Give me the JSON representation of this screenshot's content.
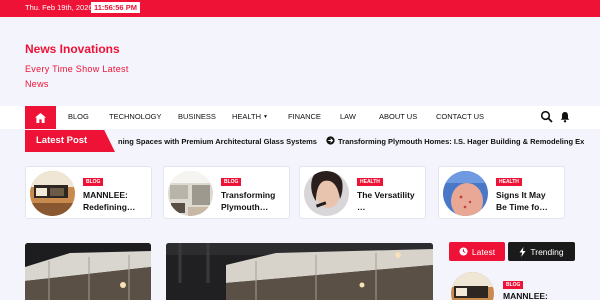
{
  "topbar": {
    "date": "Thu. Feb 19th, 2026",
    "time": "11:56:56 PM"
  },
  "site": {
    "title": "News Inovations",
    "tagline": "Every Time Show Latest News"
  },
  "nav": {
    "items": [
      {
        "label": "BLOG"
      },
      {
        "label": "TECHNOLOGY"
      },
      {
        "label": "BUSINESS"
      },
      {
        "label": "HEALTH"
      },
      {
        "label": "FINANCE"
      },
      {
        "label": "LAW"
      },
      {
        "label": "ABOUT US"
      },
      {
        "label": "CONTACT US"
      }
    ],
    "icons": {
      "home": "home-icon",
      "search": "search-icon",
      "bell": "bell-icon",
      "dropdown": "chevron-down-icon"
    }
  },
  "ticker": {
    "label": "Latest Post",
    "items": [
      "ning Spaces with Premium Architectural Glass Systems",
      "Transforming Plymouth Homes: I.S. Hager Building & Remodeling Ex"
    ]
  },
  "cards": [
    {
      "category": "BLOG",
      "title": "MANNLEE: Redefining…"
    },
    {
      "category": "BLOG",
      "title": "Transforming Plymouth…"
    },
    {
      "category": "HEALTH",
      "title": "The Versatility …"
    },
    {
      "category": "HEALTH",
      "title": "Signs It May Be Time fo…"
    }
  ],
  "tabs": {
    "latest": "Latest",
    "trending": "Trending"
  },
  "sidebar_post": {
    "category": "BLOG",
    "title": "MANNLEE:"
  },
  "colors": {
    "accent": "#ee1236",
    "dark": "#1a1a1a",
    "background": "#f4f4fc"
  }
}
